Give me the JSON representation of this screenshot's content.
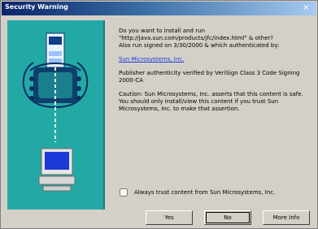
{
  "window": {
    "title": "Security Warning",
    "close_glyph": "×"
  },
  "content": {
    "line1": "Do you want to install and run",
    "line2": "\"http://java.sun.com/products/jfc/index.html\" & other?",
    "line3": "Also run signed on 3/30/2000 & which authenticated by:",
    "publisher": "Sun Microsystems, Inc.",
    "line4": "Publisher authenticity verified by VeriSign Class 3 Code Signing 2000-CA",
    "line5": "Caution: Sun Microsystems, Inc. asserts that this content is safe. You should only install/view this content if you trust Sun Microsystems, Inc. to make that assertion."
  },
  "trust": {
    "checkbox_label": "Always trust content from Sun Microsystems, Inc."
  },
  "buttons": {
    "yes": "Yes",
    "no": "No",
    "more_info": "More Info"
  }
}
